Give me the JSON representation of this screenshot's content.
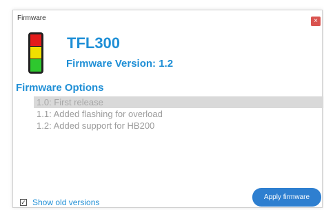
{
  "window": {
    "title": "Firmware",
    "close_glyph": "×"
  },
  "header": {
    "product_name": "TFL300",
    "firmware_version": "Firmware Version: 1.2"
  },
  "options": {
    "heading": "Firmware Options",
    "versions": [
      {
        "label": "1.0: First release",
        "selected": true
      },
      {
        "label": "1.1: Added flashing for overload",
        "selected": false
      },
      {
        "label": "1.2: Added support for HB200",
        "selected": false
      }
    ]
  },
  "footer": {
    "show_old_label": "Show old versions",
    "show_old_checked": true,
    "checkbox_glyph": "✓",
    "apply_label": "Apply firmware"
  },
  "icons": {
    "traffic_light": "traffic-light-icon",
    "close": "close-icon",
    "checkbox": "checkbox-icon"
  },
  "colors": {
    "accent": "#1f8fd6",
    "close_button": "#d9534f",
    "apply_button": "#2e7fd0",
    "light_red": "#e31b1b",
    "light_yellow": "#f0e000",
    "light_green": "#2ec82e",
    "light_housing": "#222222"
  }
}
